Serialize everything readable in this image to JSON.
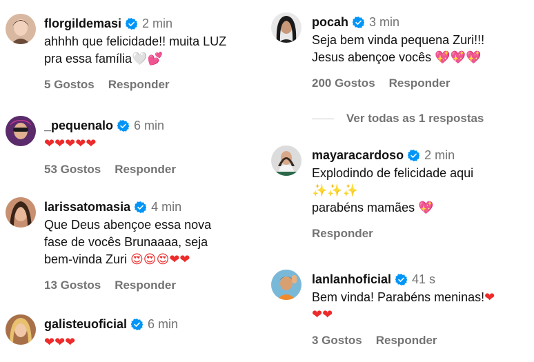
{
  "left_column": [
    {
      "username": "florgildemasi",
      "time": "2 min",
      "text": "ahhhh que felicidade!! muita LUZ\npra essa família",
      "emoji": "🤍💕",
      "likes": "5 Gostos",
      "reply": "Responder"
    },
    {
      "username": "_pequenalo",
      "time": "6 min",
      "text": "",
      "emoji": "❤❤❤❤❤",
      "likes": "53 Gostos",
      "reply": "Responder"
    },
    {
      "username": "larissatomasia",
      "time": "4 min",
      "text": "Que Deus abençoe essa nova\nfase de vocês Brunaaaa, seja\nbem-vinda Zuri ",
      "emoji": "😍😍😍❤❤",
      "likes": "13 Gostos",
      "reply": "Responder"
    },
    {
      "username": "galisteuoficial",
      "time": "6 min",
      "text": "",
      "emoji": "❤❤❤",
      "likes": "",
      "reply": ""
    }
  ],
  "right_column": [
    {
      "username": "pocah",
      "time": "3 min",
      "text": "Seja bem vinda pequena Zuri!!!\nJesus abençoe vocês ",
      "emoji": "💖💖💖",
      "likes": "200 Gostos",
      "reply": "Responder"
    },
    {
      "view_replies": "Ver todas as 1 respostas"
    },
    {
      "username": "mayaracardoso",
      "time": "2 min",
      "text": "Explodindo de felicidade aqui",
      "sparkles": "✨✨✨",
      "text2": "parabéns mamães ",
      "emoji": "💖",
      "likes": "",
      "reply": "Responder"
    },
    {
      "username": "lanlanhoficial",
      "time": "41 s",
      "text": "Bem vinda! Parabéns meninas!",
      "emoji": "❤",
      "emoji2": "❤❤",
      "likes": "3 Gostos",
      "reply": "Responder"
    }
  ],
  "colors": {
    "verified_badge": "#0095f6",
    "muted_text": "#737373",
    "heart": "#ed2b2b",
    "pink_heart": "#ff3c9a"
  },
  "icons": {
    "verified": "verified-badge-icon"
  }
}
